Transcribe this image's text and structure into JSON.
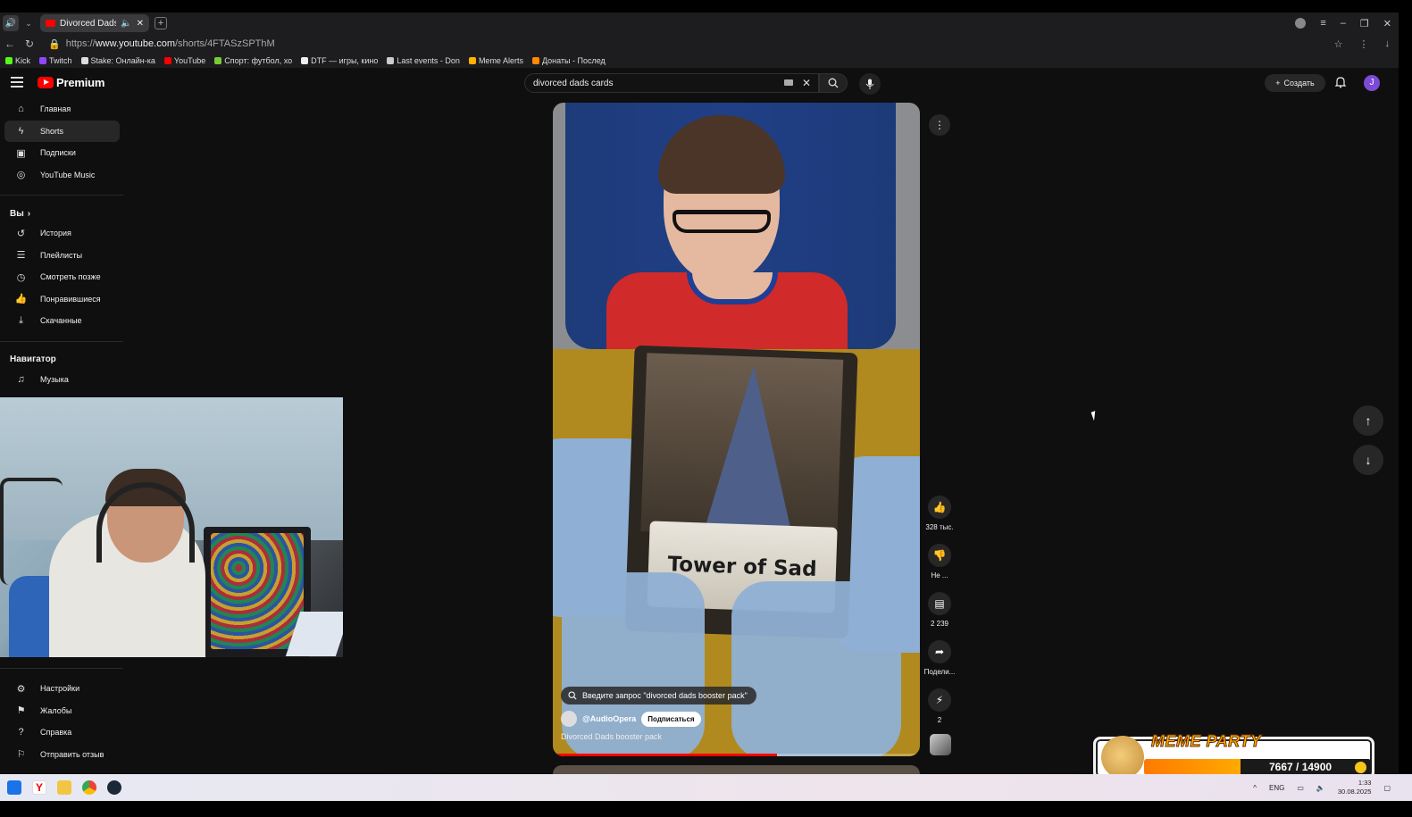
{
  "browser": {
    "tab_title": "Divorced Dads booste",
    "url_prefix": "https://",
    "url_host": "www.youtube.com",
    "url_path": "/shorts/4FTASzSPThM",
    "bookmarks": [
      "Kick",
      "Twitch",
      "Stake: Онлайн-ка",
      "YouTube",
      "Спорт: футбол, хо",
      "DTF — игры, кино",
      "Last events - Don",
      "Meme Alerts",
      "Донаты - Послед"
    ]
  },
  "yt": {
    "logo_text": "Premium",
    "search_value": "divorced dads cards",
    "create_label": "Создать",
    "avatar_letter": "J"
  },
  "sidebar": {
    "main": [
      "Главная",
      "Shorts",
      "Подписки",
      "YouTube Music"
    ],
    "you_head": "Вы",
    "you": [
      "История",
      "Плейлисты",
      "Смотреть позже",
      "Понравившиеся",
      "Скачанные"
    ],
    "nav_head": "Навигатор",
    "nav": [
      "Музыка"
    ],
    "bottom": [
      "Настройки",
      "Жалобы",
      "Справка",
      "Отправить отзыв"
    ]
  },
  "short": {
    "card_text": "Tower of Sad",
    "suggest": "Введите запрос \"divorced dads booster pack\"",
    "channel": "@AudioOpera",
    "subscribe": "Подписаться",
    "description": "Divorced Dads booster pack",
    "progress": 0.61
  },
  "actions": {
    "likes": "328 тыс.",
    "dislike": "Не ...",
    "comments": "2 239",
    "share": "Подели...",
    "remix": "2"
  },
  "overlay": {
    "brand": "MEME PARTY",
    "count": "7667 / 14900",
    "progress": 0.51
  },
  "taskbar": {
    "lang": "ENG",
    "time": "1:33",
    "date": "30.08.2025"
  }
}
